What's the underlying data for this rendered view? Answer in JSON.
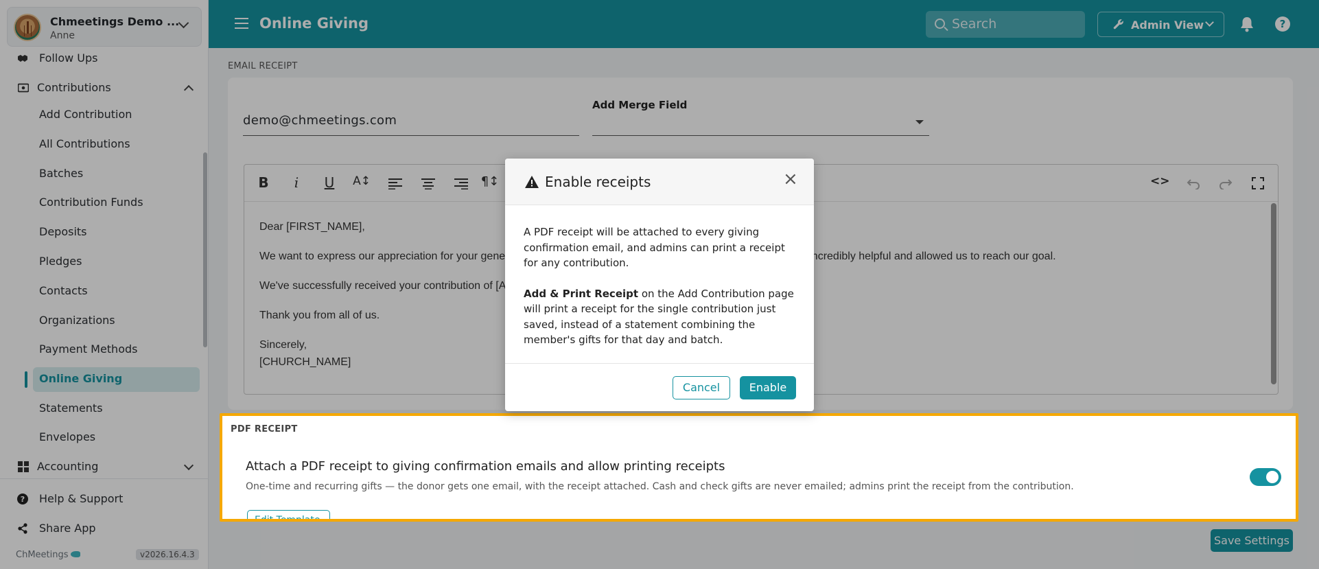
{
  "org": {
    "name": "Chmeetings Demo ...",
    "user": "Anne"
  },
  "sidebar": {
    "items": [
      {
        "label": "Follow Ups"
      },
      {
        "label": "Contributions"
      },
      {
        "label": "Add Contribution"
      },
      {
        "label": "All Contributions"
      },
      {
        "label": "Batches"
      },
      {
        "label": "Contribution Funds"
      },
      {
        "label": "Deposits"
      },
      {
        "label": "Pledges"
      },
      {
        "label": "Contacts"
      },
      {
        "label": "Organizations"
      },
      {
        "label": "Payment Methods"
      },
      {
        "label": "Online Giving"
      },
      {
        "label": "Statements"
      },
      {
        "label": "Envelopes"
      },
      {
        "label": "Accounting"
      }
    ],
    "help": "Help & Support",
    "share": "Share App",
    "brand": "ChMeetings",
    "version": "v2026.16.4.3"
  },
  "header": {
    "title": "Online Giving",
    "search_placeholder": "Search",
    "admin_view": "Admin View",
    "help_glyph": "?"
  },
  "email_receipt": {
    "section_label": "EMAIL RECEIPT",
    "email": "demo@chmeetings.com",
    "merge_label": "Add Merge Field",
    "toolbar": {
      "bold": "B",
      "italic": "i",
      "underline": "U",
      "size": "A↕",
      "para": "¶↕",
      "code": "<>"
    },
    "body": [
      "Dear [FIRST_NAME],",
      "We want to express our appreciation for your gener",
      "t was incredibly helpful and allowed us to reach our goal.",
      "We've successfully received your contribution of [AM",
      "Thank you from all of us.",
      "Sincerely,",
      "[CHURCH_NAME]"
    ]
  },
  "pdf_receipt": {
    "section_label": "PDF RECEIPT",
    "title": "Attach a PDF receipt to giving confirmation emails and allow printing receipts",
    "description": "One-time and recurring gifts — the donor gets one email, with the receipt attached. Cash and check gifts are never emailed; admins print the receipt from the contribution.",
    "edit_template": "Edit Template",
    "enabled": true
  },
  "save_settings": "Save Settings",
  "modal": {
    "title": "Enable receipts",
    "para1": "A PDF receipt will be attached to every giving confirmation email, and admins can print a receipt for any contribution.",
    "para2_bold": "Add & Print Receipt",
    "para2_rest": " on the Add Contribution page will print a receipt for the single contribution just saved, instead of a statement combining the member's gifts for that day and batch.",
    "cancel": "Cancel",
    "enable": "Enable",
    "close": "×"
  },
  "colors": {
    "brand": "#1592a0",
    "highlight": "#f5a800"
  }
}
